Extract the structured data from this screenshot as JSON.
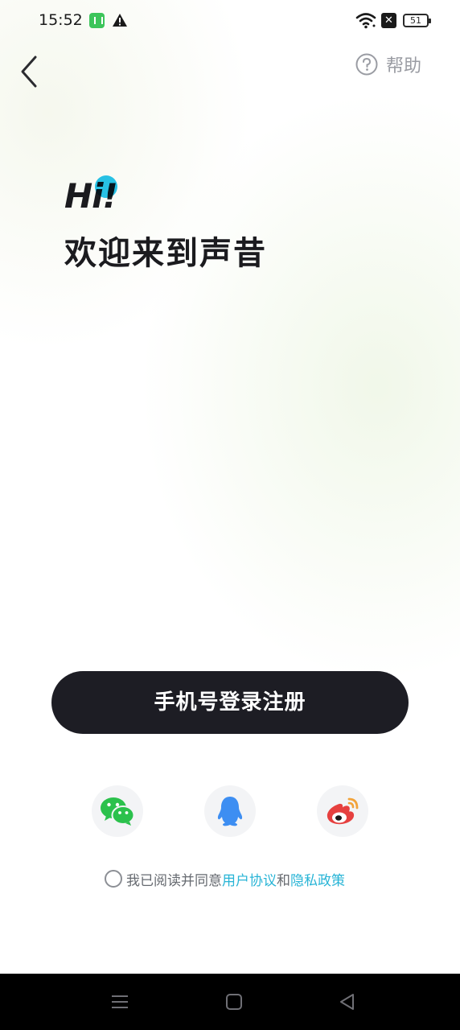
{
  "status_bar": {
    "time": "15:52",
    "battery": "51",
    "icons": [
      "app-notification-icon",
      "warning-icon",
      "wifi-icon",
      "no-sim-icon",
      "battery-icon"
    ]
  },
  "header": {
    "back_icon": "chevron-left-icon",
    "help_label": "帮助",
    "help_icon": "question-circle-icon"
  },
  "hero": {
    "greeting": "Hi!",
    "welcome": "欢迎来到声昔"
  },
  "login": {
    "phone_button": "手机号登录注册"
  },
  "social_login": [
    {
      "name": "wechat",
      "icon": "wechat-icon",
      "color": "#2bc14c"
    },
    {
      "name": "qq",
      "icon": "qq-icon",
      "color": "#3d8ef2"
    },
    {
      "name": "weibo",
      "icon": "weibo-icon",
      "color": "#e6403f"
    }
  ],
  "agreement": {
    "prefix": "我已阅读并同意 ",
    "user_agreement": "用户协议",
    "and": "和",
    "privacy_policy": "隐私政策",
    "link_color": "#28b4d6"
  },
  "nav_bar": {
    "icons": [
      "menu-icon",
      "home-icon",
      "back-triangle-icon"
    ]
  }
}
